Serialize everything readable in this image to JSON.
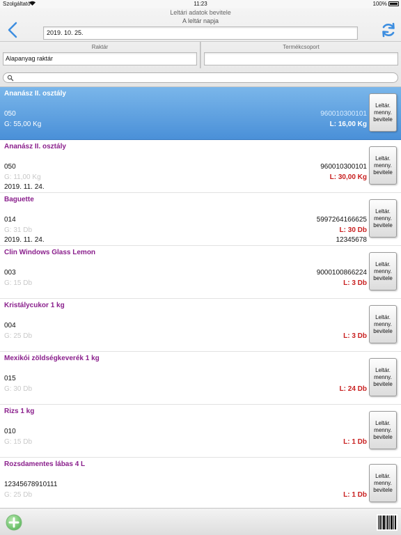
{
  "status_bar": {
    "carrier": "Szolgáltató",
    "time": "11:23",
    "battery": "100%"
  },
  "header": {
    "title": "Leltári adatok bevitele",
    "date_label": "A leltár napja",
    "date_value": "2019. 10. 25.",
    "warehouse_label": "Raktár",
    "warehouse_value": "Alapanyag raktár",
    "product_group_label": "Termékcsoport",
    "product_group_value": ""
  },
  "search": {
    "value": ""
  },
  "items": [
    {
      "name": "Ananász II. osztály",
      "code": "050",
      "g": "G: 55,00 Kg",
      "date": "",
      "barcode": "960010300101",
      "l": "L: 16,00 Kg",
      "barcode2": "",
      "button": "Leltár.\nmenny.\nbevitele"
    },
    {
      "name": "Ananász II. osztály",
      "code": "050",
      "g": "G: 11,00 Kg",
      "date": "2019. 11. 24.",
      "barcode": "960010300101",
      "l": "L: 30,00 Kg",
      "barcode2": "",
      "button": "Leltár.\nmenny.\nbevitele"
    },
    {
      "name": "Baguette",
      "code": "014",
      "g": "G: 31 Db",
      "date": "2019. 11. 24.",
      "barcode": "5997264166625",
      "l": "L: 30 Db",
      "barcode2": "12345678",
      "button": "Leltár.\nmenny.\nbevitele"
    },
    {
      "name": "Clin Windows Glass Lemon",
      "code": "003",
      "g": "G: 15 Db",
      "date": "",
      "barcode": "9000100866224",
      "l": "L: 3 Db",
      "barcode2": "",
      "button": "Leltár.\nmenny.\nbevitele"
    },
    {
      "name": "Kristálycukor 1 kg",
      "code": "004",
      "g": "G: 25 Db",
      "date": "",
      "barcode": "",
      "l": "L: 3 Db",
      "barcode2": "",
      "button": "Leltár.\nmenny.\nbevitele"
    },
    {
      "name": "Mexikói zöldségkeverék 1 kg",
      "code": "015",
      "g": "G: 30 Db",
      "date": "",
      "barcode": "",
      "l": "L: 24 Db",
      "barcode2": "",
      "button": "Leltár.\nmenny.\nbevitele"
    },
    {
      "name": "Rizs 1 kg",
      "code": "010",
      "g": "G: 15 Db",
      "date": "",
      "barcode": "",
      "l": "L: 1 Db",
      "barcode2": "",
      "button": "Leltár.\nmenny.\nbevitele"
    },
    {
      "name": "Rozsdamentes lábas 4 L",
      "code": "12345678910111",
      "g": "G: 25 Db",
      "date": "",
      "barcode": "",
      "l": "L: 1 Db",
      "barcode2": "",
      "button": "Leltár.\nmenny.\nbevitele"
    }
  ],
  "colors": {
    "accent": "#4a90d8",
    "item_name": "#8a1f8c",
    "l_value": "#c81e1e",
    "add_button": "#5cb85c"
  },
  "icons": {
    "back": "chevron-left-icon",
    "refresh": "refresh-icon",
    "search": "search-icon",
    "add": "plus-icon",
    "scan": "barcode-icon"
  }
}
